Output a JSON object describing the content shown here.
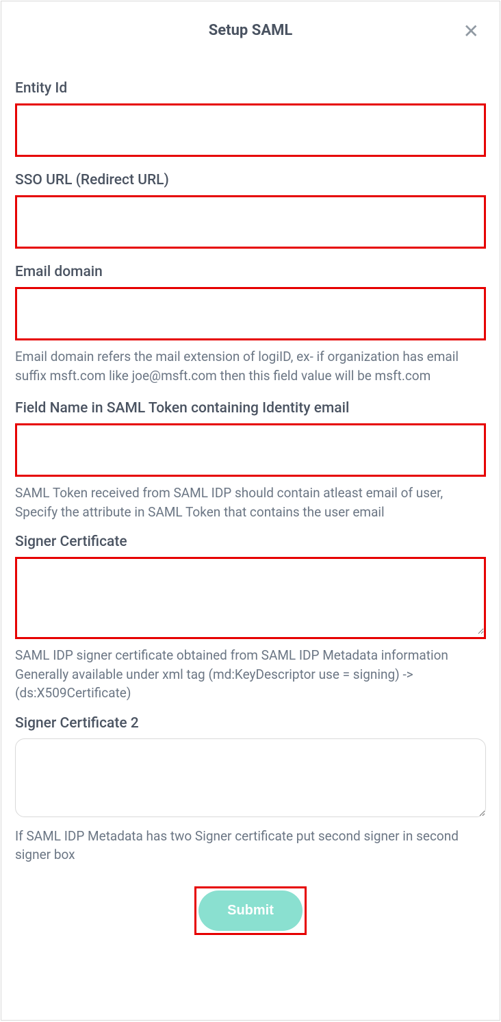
{
  "dialog": {
    "title": "Setup SAML"
  },
  "fields": {
    "entityId": {
      "label": "Entity Id",
      "value": ""
    },
    "ssoUrl": {
      "label": "SSO URL (Redirect URL)",
      "value": ""
    },
    "emailDomain": {
      "label": "Email domain",
      "value": "",
      "help": "Email domain refers the mail extension of logiID, ex- if organization has email suffix msft.com like joe@msft.com then this field value will be msft.com"
    },
    "fieldName": {
      "label": "Field Name in SAML Token containing Identity email",
      "value": "",
      "help": "SAML Token received from SAML IDP should contain atleast email of user, Specify the attribute in SAML Token that contains the user email"
    },
    "signerCert": {
      "label": "Signer Certificate",
      "value": "",
      "help": "SAML IDP signer certificate obtained from SAML IDP Metadata information Generally available under xml tag (md:KeyDescriptor use = signing) -> (ds:X509Certificate)"
    },
    "signerCert2": {
      "label": "Signer Certificate 2",
      "value": "",
      "help": "If SAML IDP Metadata has two Signer certificate put second signer in second signer box"
    }
  },
  "actions": {
    "submit": "Submit"
  }
}
